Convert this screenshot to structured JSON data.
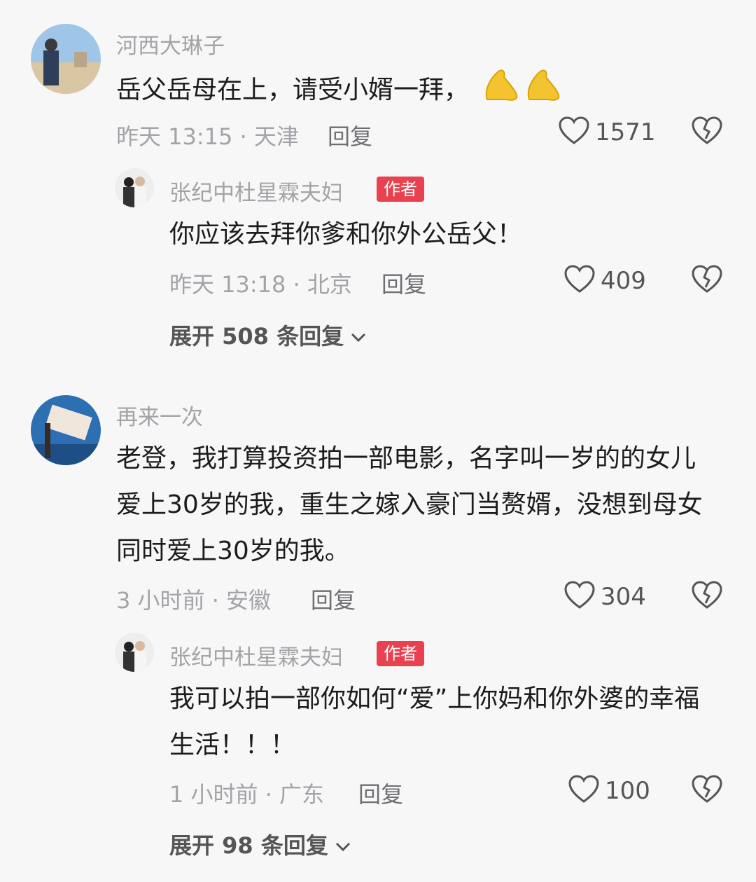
{
  "comments": [
    {
      "username": "河西大琳子",
      "content": "岳父岳母在上，请受小婿一拜，",
      "emoji": "praying-hands-emoji",
      "time_location": "昨天 13:15 · 天津",
      "reply_label": "回复",
      "likes": "1571",
      "reply": {
        "username": "张纪中杜星霖夫妇",
        "badge": "作者",
        "content": "你应该去拜你爹和你外公岳父！",
        "time_location": "昨天 13:18 · 北京",
        "reply_label": "回复",
        "likes": "409"
      },
      "expand_label": "展开 508 条回复"
    },
    {
      "username": "再来一次",
      "content": "老登，我打算投资拍一部电影，名字叫一岁的的女儿爱上30岁的我，重生之嫁入豪门当赘婿，没想到母女同时爱上30岁的我。",
      "time_location": "3 小时前 · 安徽",
      "reply_label": "回复",
      "likes": "304",
      "reply": {
        "username": "张纪中杜星霖夫妇",
        "badge": "作者",
        "content": "我可以拍一部你如何“爱”上你妈和你外婆的幸福生活！！！",
        "time_location": "1 小时前 · 广东",
        "reply_label": "回复",
        "likes": "100"
      },
      "expand_label": "展开 98 条回复"
    }
  ],
  "colors": {
    "background": "#f7f7f8",
    "badge": "#e9414f",
    "muted_text": "#a3a3a8"
  }
}
